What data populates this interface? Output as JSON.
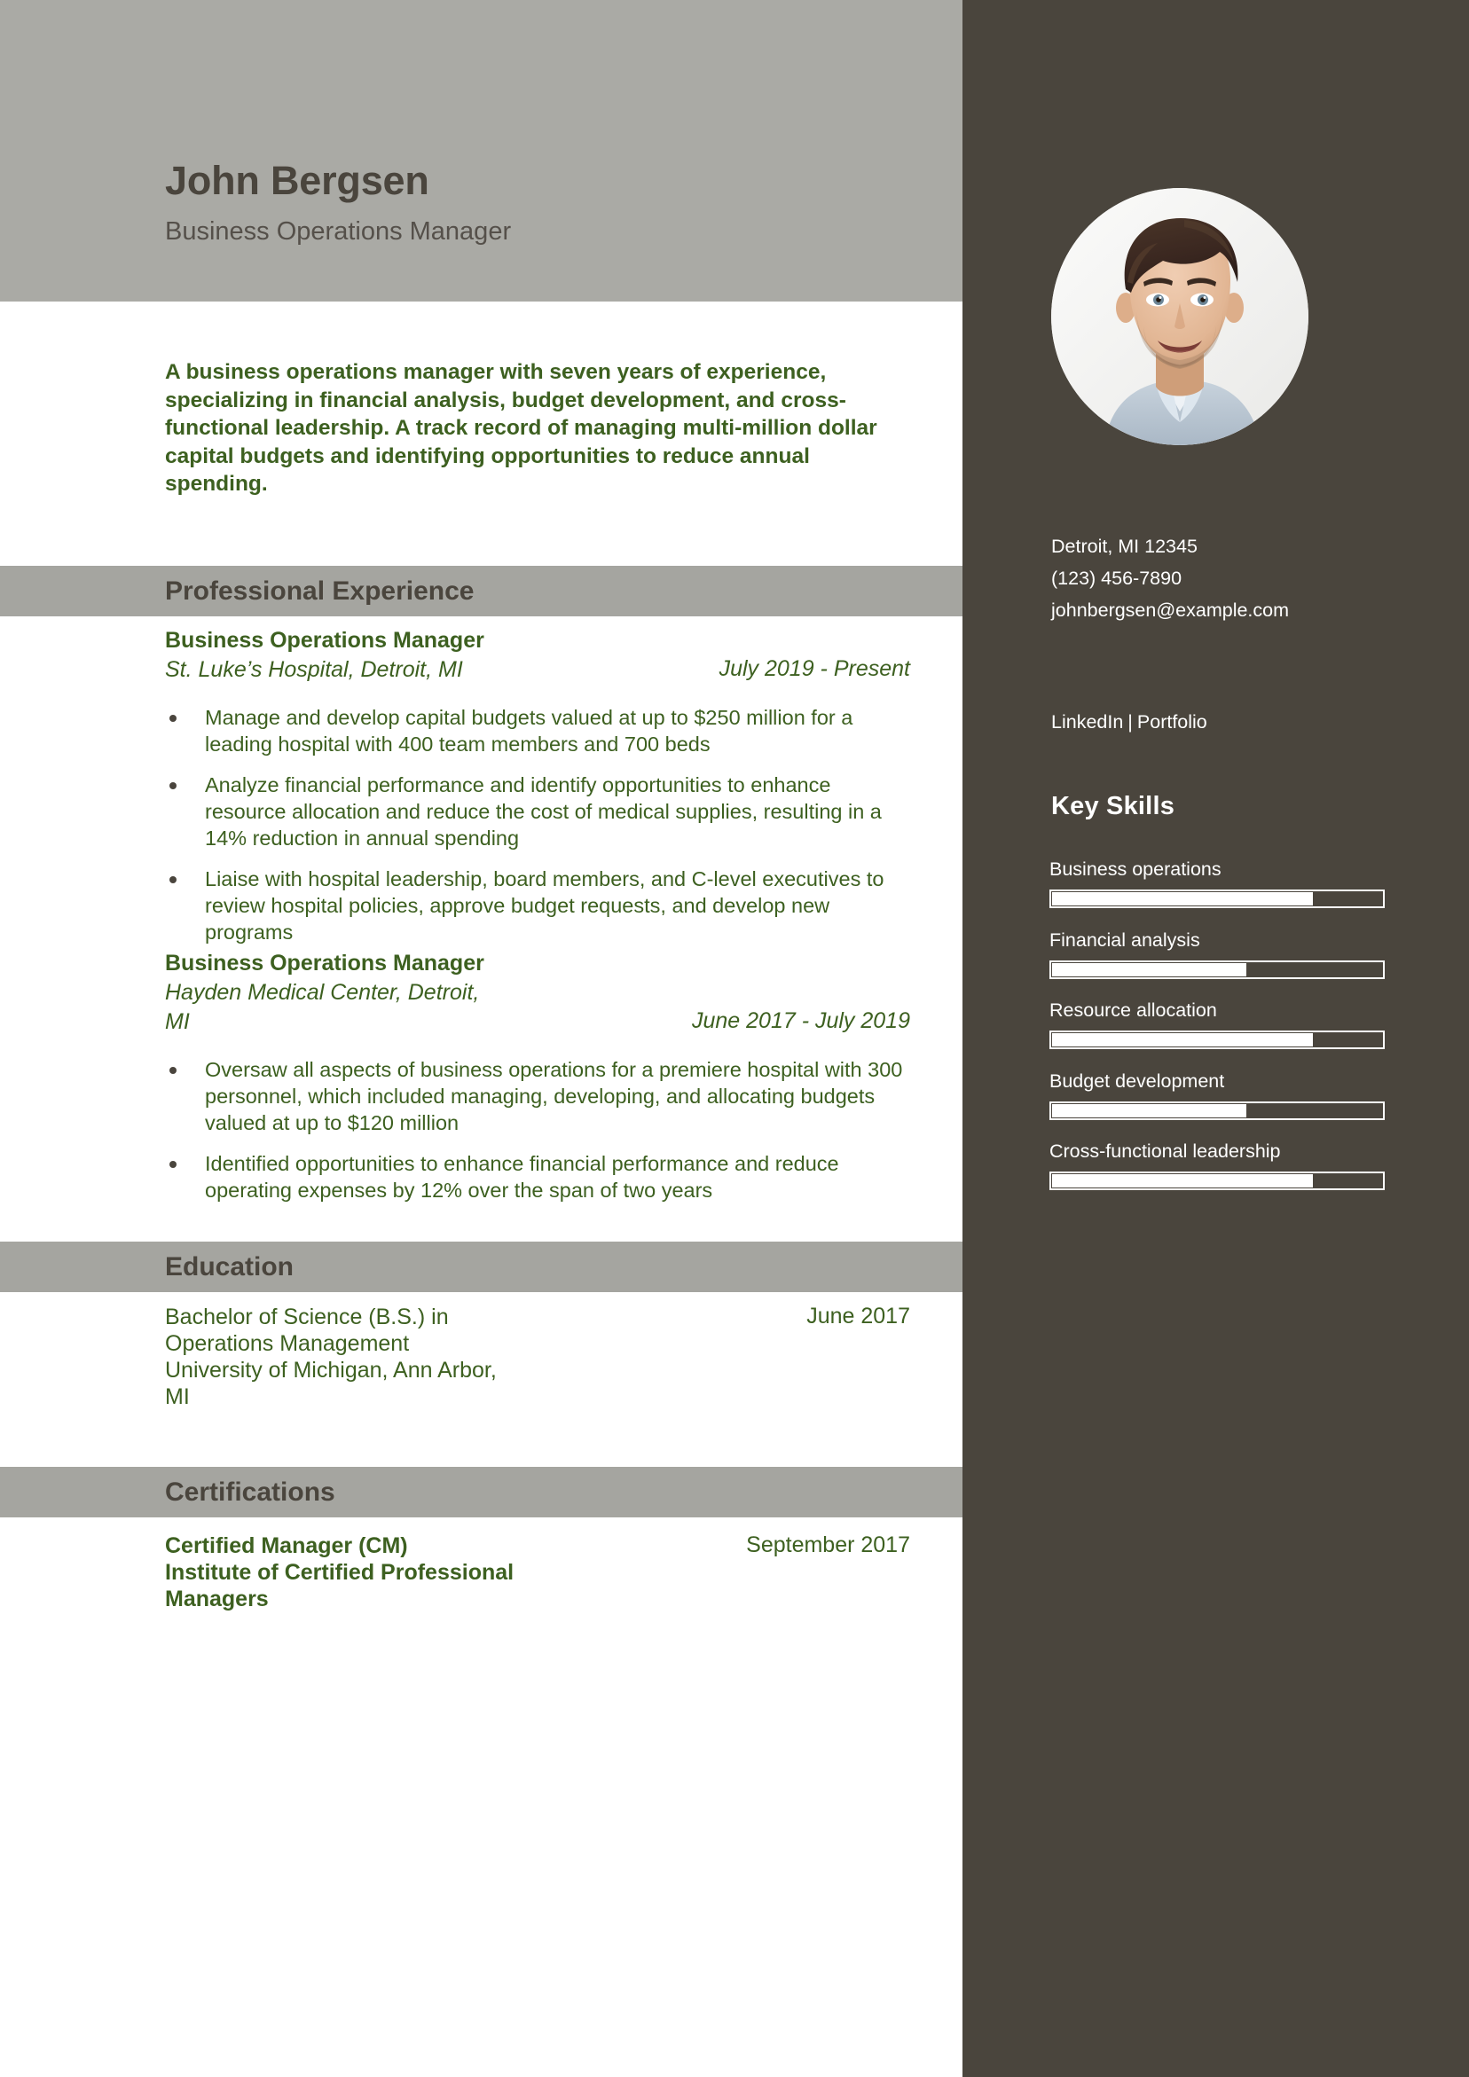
{
  "header": {
    "name": "John Bergsen",
    "job_title": "Business Operations Manager",
    "band_color": "#aaaaa5",
    "name_color": "#4a453d"
  },
  "summary": {
    "text": "A business operations manager with seven years of experience, specializing in financial analysis, budget development, and cross-functional leadership. A track record of managing multi-million dollar capital budgets and identifying opportunities to reduce annual spending."
  },
  "accent_color": "#3d6020",
  "sidebar_color": "#4a453d",
  "sections": {
    "experience_heading": "Professional Experience",
    "education_heading": "Education",
    "certifications_heading": "Certifications"
  },
  "experience": [
    {
      "role": "Business Operations Manager",
      "org_line1": "St. Luke’s Hospital, Detroit, MI",
      "org_line2": "",
      "dates": "July 2019 - Present",
      "bullets": [
        "Manage and develop capital budgets valued at up to $250 million for a leading hospital with 400 team members and 700 beds",
        "Analyze financial performance and identify opportunities to enhance resource allocation and reduce the cost of medical supplies, resulting in a 14% reduction in annual spending",
        "Liaise with hospital leadership, board members, and C-level executives to review hospital policies, approve budget requests, and develop new programs"
      ]
    },
    {
      "role": "Business Operations Manager",
      "org_line1": "Hayden Medical Center, Detroit,",
      "org_line2": "MI",
      "dates": "June 2017 - July 2019",
      "bullets": [
        "Oversaw all aspects of business operations for a premiere hospital with 300 personnel, which included managing, developing, and allocating budgets valued at up to $120 million",
        "Identified opportunities to enhance financial performance and reduce operating expenses by 12% over the span of two years"
      ]
    }
  ],
  "education": [
    {
      "degree_line1": "Bachelor of Science (B.S.) in",
      "degree_line2": "Operations Management",
      "school_line1": "University of Michigan, Ann Arbor,",
      "school_line2": "MI",
      "date": "June 2017"
    }
  ],
  "certifications": [
    {
      "name": "Certified Manager (CM)",
      "issuer_line1": "Institute of Certified Professional",
      "issuer_line2": "Managers",
      "date": "September 2017"
    }
  ],
  "contact": {
    "location": "Detroit, MI 12345",
    "phone": "(123) 456-7890",
    "email": "johnbergsen@example.com",
    "linkedin_label": "LinkedIn",
    "separator": "|",
    "portfolio_label": "Portfolio"
  },
  "skills": {
    "title": "Key Skills",
    "items": [
      {
        "label": "Business operations",
        "level": 79
      },
      {
        "label": "Financial analysis",
        "level": 59
      },
      {
        "label": "Resource allocation",
        "level": 79
      },
      {
        "label": "Budget development",
        "level": 59
      },
      {
        "label": "Cross-functional leadership",
        "level": 79
      }
    ]
  }
}
